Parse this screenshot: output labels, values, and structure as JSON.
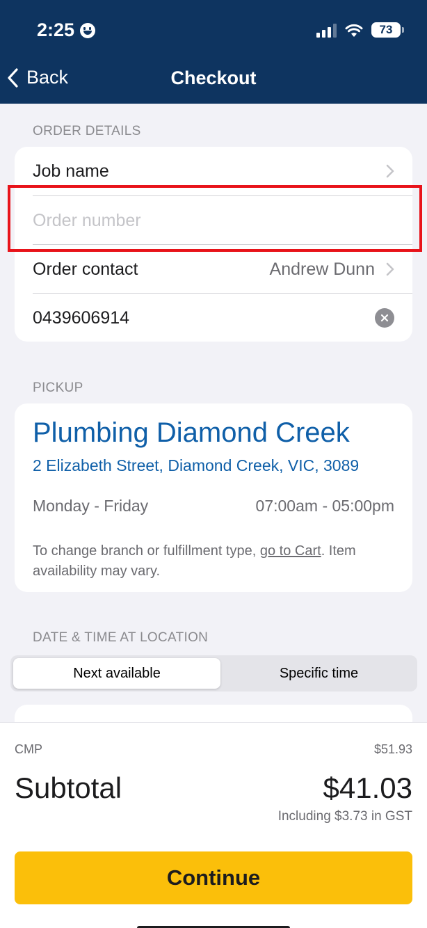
{
  "status_bar": {
    "time": "2:25",
    "battery": "73"
  },
  "nav": {
    "back_label": "Back",
    "title": "Checkout"
  },
  "order_details": {
    "section_label": "ORDER DETAILS",
    "job_name_label": "Job name",
    "order_number_placeholder": "Order number",
    "order_contact_label": "Order contact",
    "order_contact_value": "Andrew Dunn",
    "phone_value": "0439606914"
  },
  "pickup": {
    "section_label": "PICKUP",
    "branch_name": "Plumbing Diamond Creek",
    "branch_address": "2 Elizabeth Street, Diamond Creek, VIC, 3089",
    "hours_days": "Monday - Friday",
    "hours_times": "07:00am - 05:00pm",
    "note_before": "To change branch or fulfillment type, ",
    "note_link": "go to Cart",
    "note_after": ". Item availability may vary."
  },
  "date_time": {
    "section_label": "DATE & TIME AT LOCATION",
    "options": [
      "Next available",
      "Specific time"
    ],
    "selected": "Next available"
  },
  "summary": {
    "cmp_label": "CMP",
    "cmp_value": "$51.93",
    "subtotal_label": "Subtotal",
    "subtotal_value": "$41.03",
    "gst_note": "Including $3.73 in GST",
    "continue_label": "Continue"
  },
  "colors": {
    "header_bg": "#0e3460",
    "link_blue": "#0f5fa8",
    "continue_yellow": "#fbbf0a",
    "highlight_red": "#e8131a"
  }
}
